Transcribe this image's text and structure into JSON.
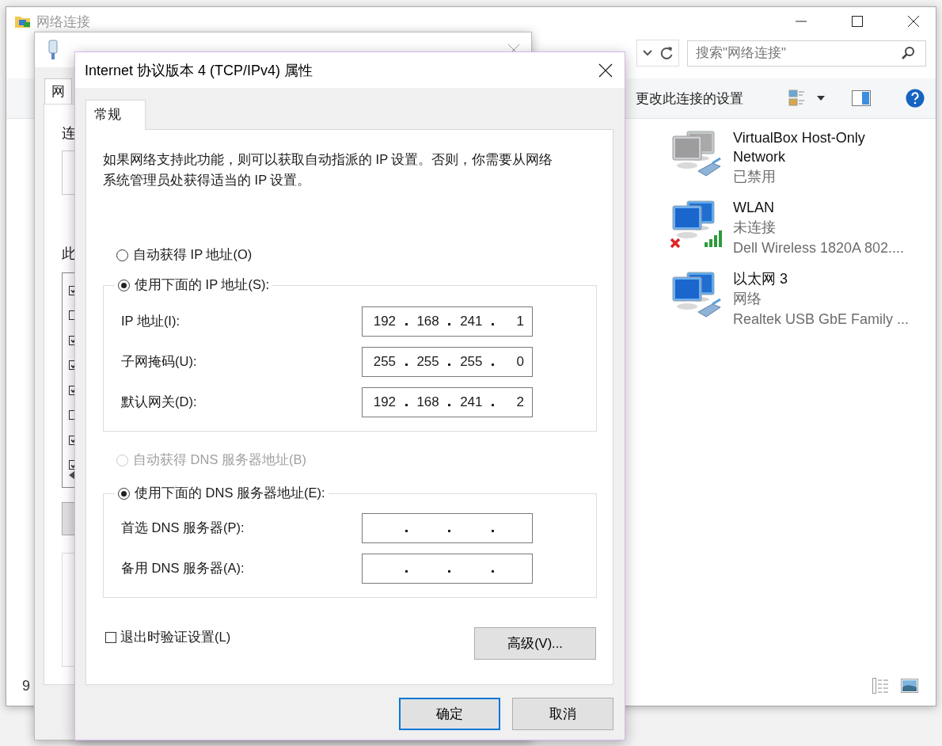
{
  "explorer": {
    "title": "网络连接",
    "search": {
      "placeholder": "搜索\"网络连接\""
    },
    "toolbar": {
      "action": "更改此连接的设置"
    },
    "connections": [
      {
        "name": "VirtualBox Host-Only Network",
        "status": "已禁用",
        "kind": "wired",
        "disabled": true,
        "disconnected": false
      },
      {
        "name": "WLAN",
        "status": "未连接",
        "device": "Dell Wireless 1820A 802....",
        "kind": "wireless",
        "disabled": false,
        "disconnected": true
      },
      {
        "name": "以太网 3",
        "status": "网络",
        "device": "Realtek USB GbE Family ...",
        "kind": "wired",
        "disabled": false,
        "disconnected": false
      }
    ],
    "status_bar": "9"
  },
  "adapter_dialog": {
    "tab": "网",
    "label_1": "连",
    "label_2": "此",
    "components": [
      {
        "checked": true
      },
      {
        "checked": false
      },
      {
        "checked": true
      },
      {
        "checked": true
      },
      {
        "checked": true
      },
      {
        "checked": false
      },
      {
        "checked": true
      },
      {
        "checked": true
      }
    ]
  },
  "ipv4_dialog": {
    "title": "Internet 协议版本 4 (TCP/IPv4) 属性",
    "tabs": [
      {
        "label": "常规",
        "selected": true
      }
    ],
    "description": "如果网络支持此功能，则可以获取自动指派的 IP 设置。否则，你需要从网络系统管理员处获得适当的 IP 设置。",
    "ip_mode": [
      {
        "label": "自动获得 IP 地址(O)",
        "selected": false
      },
      {
        "label": "使用下面的 IP 地址(S):",
        "selected": true
      }
    ],
    "ip_fields": [
      {
        "label": "IP 地址(I):",
        "octets": [
          "192",
          "168",
          "241",
          "1"
        ]
      },
      {
        "label": "子网掩码(U):",
        "octets": [
          "255",
          "255",
          "255",
          "0"
        ]
      },
      {
        "label": "默认网关(D):",
        "octets": [
          "192",
          "168",
          "241",
          "2"
        ]
      }
    ],
    "dns_mode": [
      {
        "label": "自动获得 DNS 服务器地址(B)",
        "selected": false,
        "disabled": true
      },
      {
        "label": "使用下面的 DNS 服务器地址(E):",
        "selected": true,
        "disabled": false
      }
    ],
    "dns_fields": [
      {
        "label": "首选 DNS 服务器(P):"
      },
      {
        "label": "备用 DNS 服务器(A):"
      }
    ],
    "validate": {
      "label": "退出时验证设置(L)",
      "checked": false
    },
    "advanced_button": "高级(V)...",
    "buttons": [
      {
        "label": "确定",
        "default": true
      },
      {
        "label": "取消",
        "default": false
      }
    ]
  }
}
